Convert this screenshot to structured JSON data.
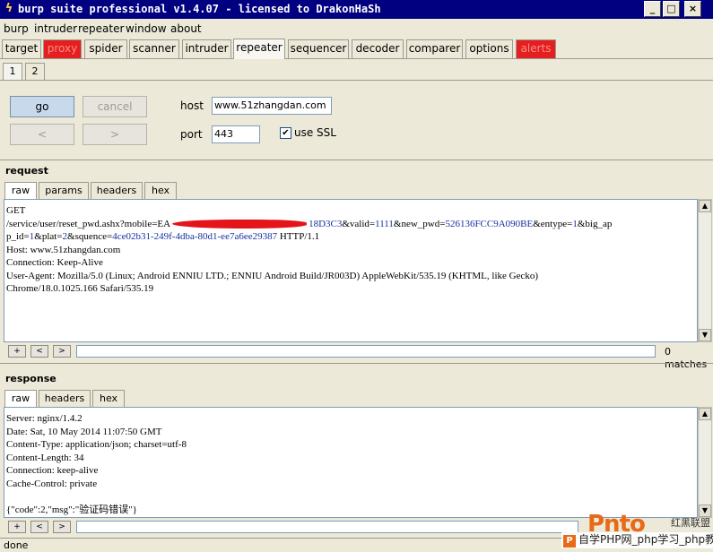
{
  "window": {
    "title": "burp suite professional v1.4.07 - licensed to DrakonHaSh",
    "min_glyph": "_",
    "max_glyph": "□",
    "close_glyph": "×"
  },
  "menu": [
    "burp",
    "intruder",
    "repeater",
    "window",
    "about"
  ],
  "main_tabs": [
    {
      "label": "target"
    },
    {
      "label": "proxy"
    },
    {
      "label": "spider"
    },
    {
      "label": "scanner"
    },
    {
      "label": "intruder"
    },
    {
      "label": "repeater"
    },
    {
      "label": "sequencer"
    },
    {
      "label": "decoder"
    },
    {
      "label": "comparer"
    },
    {
      "label": "options"
    },
    {
      "label": "alerts"
    }
  ],
  "active_main_tab": "repeater",
  "highlight_color": "#e41f1f",
  "sub_tabs": [
    "1",
    "2"
  ],
  "active_sub_tab": "1",
  "controls": {
    "go": "go",
    "cancel": "cancel",
    "prev": "<",
    "next": ">",
    "host_label": "host",
    "host_value": "www.51zhangdan.com",
    "port_label": "port",
    "port_value": "443",
    "use_ssl_label": "use SSL",
    "use_ssl_checked": "✔"
  },
  "request": {
    "title": "request",
    "tabs": [
      "raw",
      "params",
      "headers",
      "hex"
    ],
    "active_tab": "raw",
    "lines": {
      "l0": "GET",
      "l1_a": "/service/user/reset_pwd.ashx?mobile=EA",
      "l1_b": "18D3C3",
      "l1_c": "&valid=",
      "l1_d": "1111",
      "l1_e": "&new_pwd=",
      "l1_f": "526136FCC9A090BE",
      "l1_g": "&entype=",
      "l1_h": "1",
      "l1_i": "&big_ap",
      "l2_a": "p_id=",
      "l2_b": "1",
      "l2_c": "&plat=",
      "l2_d": "2",
      "l2_e": "&squence=",
      "l2_f": "4ce02b31-249f-4dba-80d1-ee7a6ee29387",
      "l2_g": " HTTP/1.1",
      "l3": "Host: www.51zhangdan.com",
      "l4": "Connection: Keep-Alive",
      "l5": "User-Agent: Mozilla/5.0 (Linux; Android ENNIU LTD.; ENNIU Android Build/JR003D) AppleWebKit/535.19 (KHTML, like Gecko)",
      "l6": "Chrome/18.0.1025.166  Safari/535.19"
    },
    "search": {
      "plus": "+",
      "prev": "<",
      "next": ">",
      "matches": "0 matches"
    }
  },
  "response": {
    "title": "response",
    "tabs": [
      "raw",
      "headers",
      "hex"
    ],
    "active_tab": "raw",
    "lines": [
      "Server: nginx/1.4.2",
      "Date: Sat, 10 May 2014 11:07:50 GMT",
      "Content-Type: application/json; charset=utf-8",
      "Content-Length: 34",
      "Connection: keep-alive",
      "Cache-Control: private",
      "",
      "{\"code\":2,\"msg\":\"验证码错误\"}"
    ],
    "search": {
      "plus": "+",
      "prev": "<",
      "next": ">"
    }
  },
  "scroll": {
    "up": "▲",
    "down": "▼"
  },
  "status": "done",
  "watermark": {
    "logo": "Pnto",
    "sub": "红黑联盟",
    "badge": "P",
    "line": "自学PHP网_php学习_php教"
  }
}
